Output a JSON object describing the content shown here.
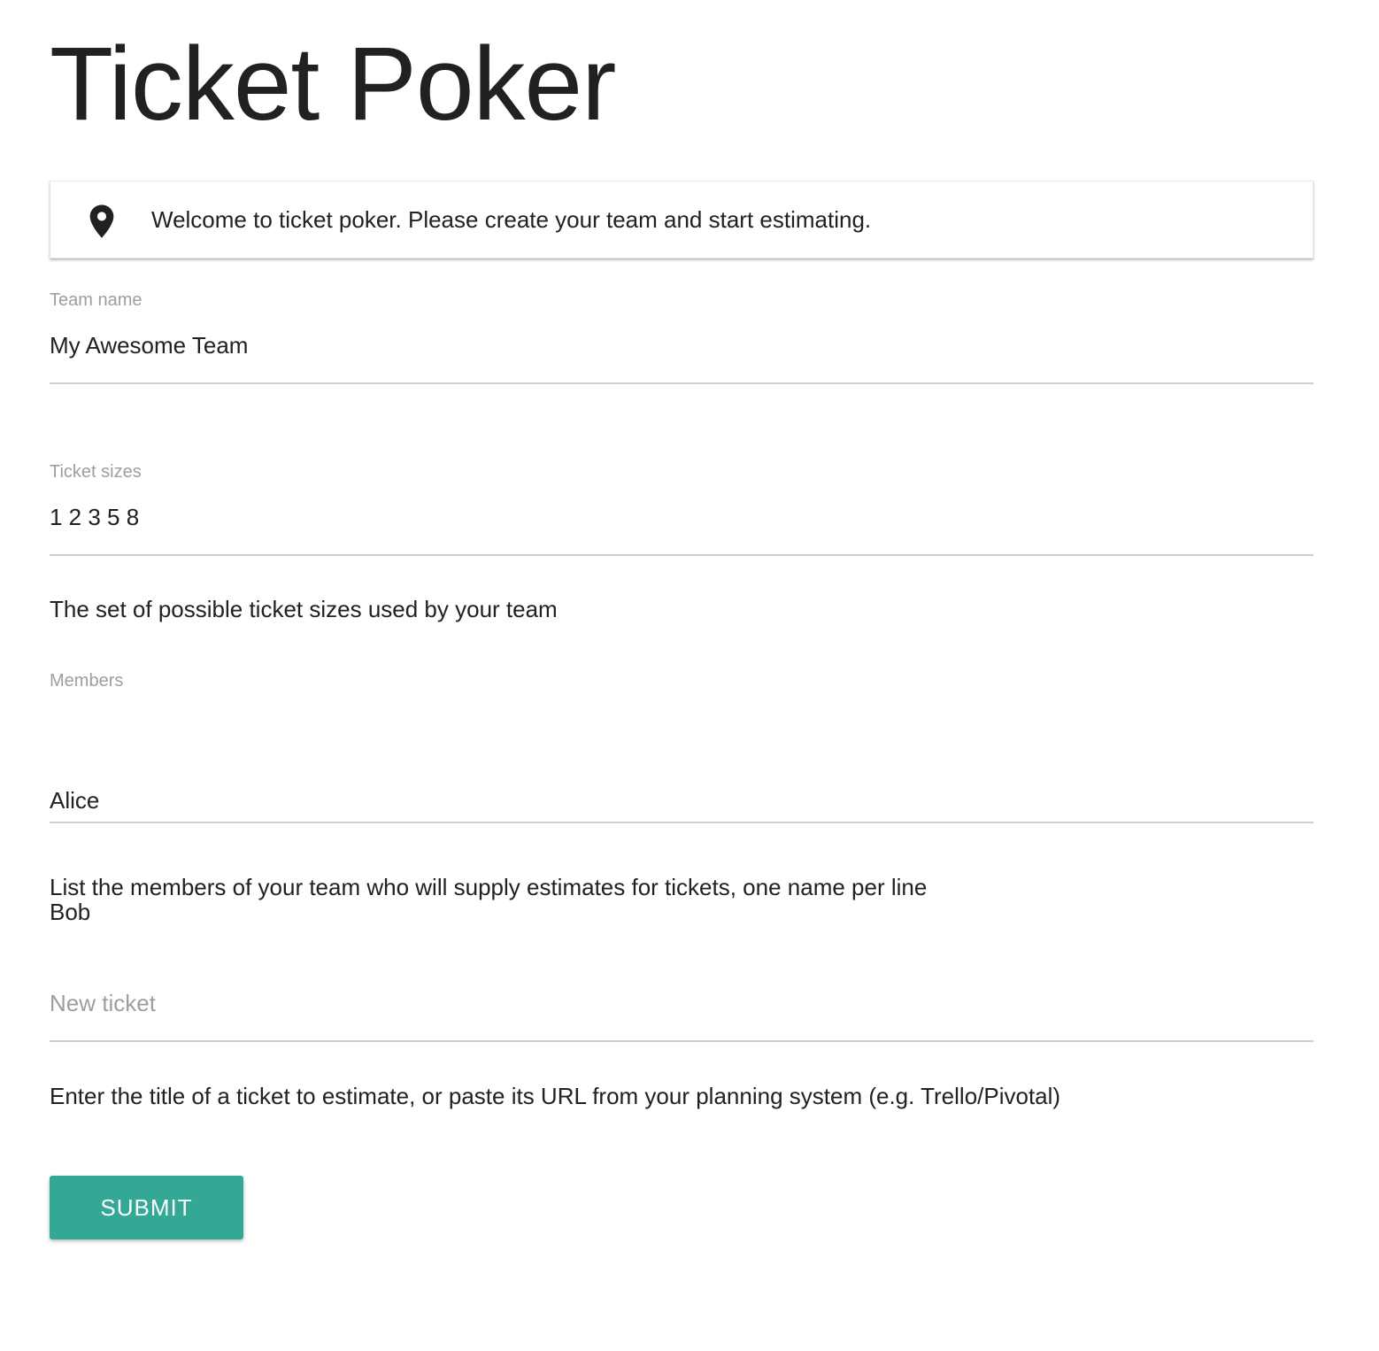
{
  "app": {
    "title": "Ticket Poker"
  },
  "notice": {
    "icon": "map-marker-icon",
    "text": "Welcome to ticket poker. Please create your team and start estimating."
  },
  "form": {
    "team_name": {
      "label": "Team name",
      "value": "My Awesome Team"
    },
    "ticket_sizes": {
      "label": "Ticket sizes",
      "value": "1 2 3 5 8",
      "helper": "The set of possible ticket sizes used by your team"
    },
    "members": {
      "label": "Members",
      "value_lines": [
        "Alice",
        "Bob"
      ],
      "helper": "List the members of your team who will supply estimates for tickets, one name per line"
    },
    "new_ticket": {
      "placeholder": "New ticket",
      "value": "",
      "helper": "Enter the title of a ticket to estimate, or paste its URL from your planning system (e.g. Trello/Pivotal)"
    },
    "submit_label": "SUBMIT"
  },
  "colors": {
    "accent": "#33a897",
    "text": "#212121",
    "label": "#9e9e9e",
    "underline": "#cfcfcf"
  }
}
